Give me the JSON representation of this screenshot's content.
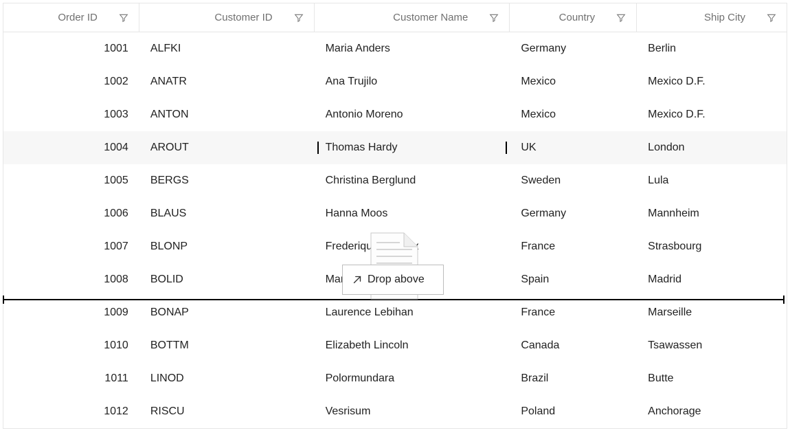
{
  "columns": [
    {
      "key": "orderid",
      "label": "Order ID"
    },
    {
      "key": "custid",
      "label": "Customer ID"
    },
    {
      "key": "custname",
      "label": "Customer Name"
    },
    {
      "key": "country",
      "label": "Country"
    },
    {
      "key": "shipcity",
      "label": "Ship City"
    }
  ],
  "rows": [
    {
      "orderid": "1001",
      "custid": "ALFKI",
      "custname": "Maria Anders",
      "country": "Germany",
      "shipcity": "Berlin"
    },
    {
      "orderid": "1002",
      "custid": "ANATR",
      "custname": "Ana Trujilo",
      "country": "Mexico",
      "shipcity": "Mexico D.F."
    },
    {
      "orderid": "1003",
      "custid": "ANTON",
      "custname": "Antonio Moreno",
      "country": "Mexico",
      "shipcity": "Mexico D.F."
    },
    {
      "orderid": "1004",
      "custid": "AROUT",
      "custname": "Thomas Hardy",
      "country": "UK",
      "shipcity": "London"
    },
    {
      "orderid": "1005",
      "custid": "BERGS",
      "custname": "Christina Berglund",
      "country": "Sweden",
      "shipcity": "Lula"
    },
    {
      "orderid": "1006",
      "custid": "BLAUS",
      "custname": "Hanna Moos",
      "country": "Germany",
      "shipcity": "Mannheim"
    },
    {
      "orderid": "1007",
      "custid": "BLONP",
      "custname": "Frederique Citeaux",
      "country": "France",
      "shipcity": "Strasbourg"
    },
    {
      "orderid": "1008",
      "custid": "BOLID",
      "custname": "Martin Sommer",
      "country": "Spain",
      "shipcity": "Madrid"
    },
    {
      "orderid": "1009",
      "custid": "BONAP",
      "custname": "Laurence Lebihan",
      "country": "France",
      "shipcity": "Marseille"
    },
    {
      "orderid": "1010",
      "custid": "BOTTM",
      "custname": "Elizabeth Lincoln",
      "country": "Canada",
      "shipcity": "Tsawassen"
    },
    {
      "orderid": "1011",
      "custid": "LINOD",
      "custname": "Polormundara",
      "country": "Brazil",
      "shipcity": "Butte"
    },
    {
      "orderid": "1012",
      "custid": "RISCU",
      "custname": "Vesrisum",
      "country": "Poland",
      "shipcity": "Anchorage"
    }
  ],
  "drag": {
    "label": "Drop above",
    "selected_row_index": 3,
    "selected_col_key": "custname",
    "drop_before_row_index": 8
  }
}
